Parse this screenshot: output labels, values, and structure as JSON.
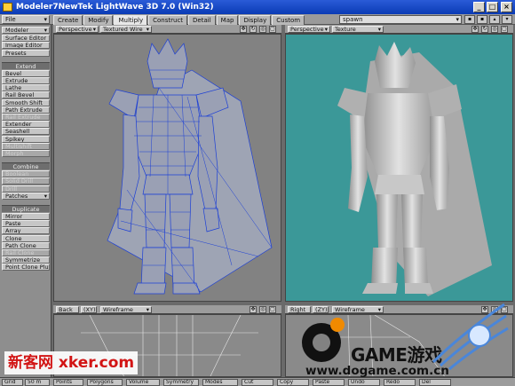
{
  "window": {
    "title": "Modeler7NewTek LightWave 3D 7.0 (Win32)",
    "minimize": "_",
    "maximize": "□",
    "close": "×"
  },
  "menu": {
    "file_label": "File",
    "tabs": [
      "Create",
      "Modify",
      "Multiply",
      "Construct",
      "Detail",
      "Map",
      "Display",
      "Custom"
    ],
    "active_tab": "Multiply",
    "layer_field": "spawn"
  },
  "toolpanel": {
    "top_buttons": [
      "Modeler",
      "Surface Editor",
      "Image Editor",
      "Presets"
    ],
    "extend_header": "Extend",
    "extend_items": [
      "Bevel",
      "Extrude",
      "Lathe",
      "Rail Bevel",
      "Smooth Shift",
      "Path Extrude",
      "Rail Extrude",
      "Extender",
      "Seashell",
      "Spikey",
      "Multishift",
      "Morph"
    ],
    "combine_header": "Combine",
    "combine_items": [
      "Boolean",
      "Solid Drill",
      "Drill",
      "Patches"
    ],
    "duplicate_header": "Duplicate",
    "duplicate_items": [
      "Mirror",
      "Paste",
      "Array",
      "Clone",
      "Path Clone",
      "Rail Clone",
      "Symmetrize",
      "Point Clone Plus"
    ]
  },
  "viewports": {
    "top_left": {
      "view": "Perspective",
      "mode": "Textured Wire"
    },
    "top_right": {
      "view": "Perspective",
      "mode": "Texture"
    },
    "bottom_left": {
      "view": "Back",
      "axis": "(XY)",
      "mode": "Wireframe"
    },
    "bottom_right": {
      "view": "Right",
      "axis": "(ZY)",
      "mode": "Wireframe"
    }
  },
  "statusbar": {
    "grid": "Grid",
    "grid_value": "50 m",
    "points": "Points",
    "polygons": "Polygons",
    "volume": "Volume",
    "symmetry": "Symmetry",
    "modes": "Modes",
    "cut": "Cut",
    "copy": "Copy",
    "paste": "Paste",
    "undo": "Undo",
    "redo": "Redo",
    "delete": "Del"
  },
  "watermarks": {
    "left": "新客网 xker.com",
    "game": "GAME游戏",
    "url": "www.dogame.com.cn"
  },
  "colors": {
    "wire_viewport_bg": "#828282",
    "texture_viewport_bg": "#3b9898",
    "wire_color": "#1c3fd6",
    "model_gray": "#b8b8b8"
  }
}
